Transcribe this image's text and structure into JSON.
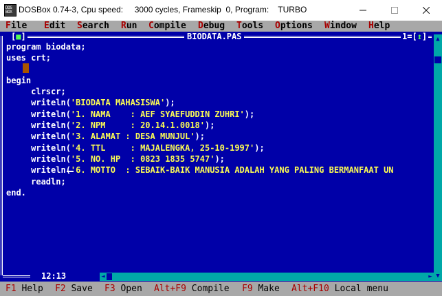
{
  "window": {
    "icon_text": "DOS\nBOX",
    "title": "DOSBox 0.74-3, Cpu speed:     3000 cycles, Frameskip  0, Program:    TURBO",
    "minimize_icon": "minimize-icon",
    "maximize_icon": "maximize-icon",
    "close_icon": "close-icon"
  },
  "menu": [
    {
      "hot": "F",
      "rest": "ile"
    },
    {
      "hot": "E",
      "rest": "dit"
    },
    {
      "hot": "S",
      "rest": "earch"
    },
    {
      "hot": "R",
      "rest": "un"
    },
    {
      "hot": "C",
      "rest": "ompile"
    },
    {
      "hot": "D",
      "rest": "ebug"
    },
    {
      "hot": "T",
      "rest": "ools"
    },
    {
      "hot": "O",
      "rest": "ptions"
    },
    {
      "hot": "W",
      "rest": "indow"
    },
    {
      "hot": "H",
      "rest": "elp"
    }
  ],
  "editor": {
    "close_box_open": "[",
    "close_box_mark": "■",
    "close_box_close": "]",
    "file_name": "BIODATA.PAS",
    "window_number": "1=[",
    "zoom_mark": "↕",
    "window_number_close": "]",
    "position": "12:13",
    "lines": [
      {
        "pre": "program biodata;",
        "str": "",
        "post": ""
      },
      {
        "pre": "uses crt;",
        "str": "",
        "post": ""
      },
      {
        "pre": "",
        "str": "",
        "post": ""
      },
      {
        "pre": "begin",
        "str": "",
        "post": ""
      },
      {
        "pre": "     clrscr;",
        "str": "",
        "post": ""
      },
      {
        "pre": "     writeln(",
        "str": "'BIODATA MAHASISWA'",
        "post": ");"
      },
      {
        "pre": "     writeln(",
        "str": "'1. NAMA    : AEF SYAEFUDDIN ZUHRI'",
        "post": ");"
      },
      {
        "pre": "     writeln(",
        "str": "'2. NPM     : 20.14.1.0018'",
        "post": ");"
      },
      {
        "pre": "     writeln(",
        "str": "'3. ALAMAT : DESA MUNJUL'",
        "post": ");"
      },
      {
        "pre": "     writeln(",
        "str": "'4. TTL     : MAJALENGKA, 25-10-1997'",
        "post": ");"
      },
      {
        "pre": "     writeln(",
        "str": "'5. NO. HP  : 0823 1835 5747'",
        "post": ");"
      },
      {
        "pre": "     writeln(",
        "str": "'6. MOTTO  : SEBAIK-BAIK MANUSIA ADALAH YANG PALING BERMANFAAT UN",
        "post": ""
      },
      {
        "pre": "     readln;",
        "str": "",
        "post": ""
      },
      {
        "pre": "end.",
        "str": "",
        "post": ""
      }
    ]
  },
  "status": [
    {
      "key": "F1",
      "label": " Help"
    },
    {
      "key": "F2",
      "label": " Save"
    },
    {
      "key": "F3",
      "label": " Open"
    },
    {
      "key": "Alt+F9",
      "label": " Compile"
    },
    {
      "key": "F9",
      "label": " Make"
    },
    {
      "key": "Alt+F10",
      "label": " Local menu"
    }
  ],
  "colors": {
    "dos_blue": "#0000a8",
    "dos_gray": "#a8a8a8",
    "dos_red": "#a80000",
    "dos_yellow": "#fcfc54",
    "dos_cyan": "#00a8a8"
  }
}
